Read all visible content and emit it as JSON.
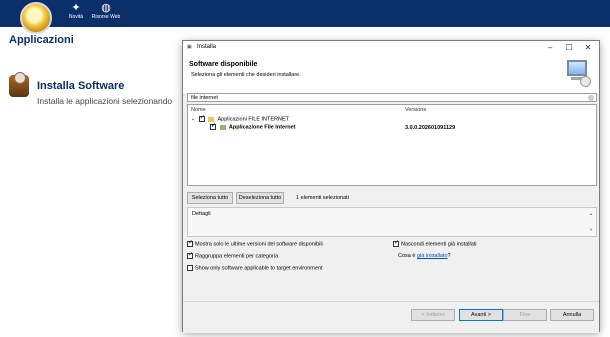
{
  "toolbar": {
    "news": {
      "label": "Novità",
      "icon": "star-icon"
    },
    "web": {
      "label": "Risorse Web",
      "icon": "globe-icon"
    }
  },
  "left": {
    "title": "Applicazioni",
    "install_title": "Installa Software",
    "install_desc": "Installa le applicazioni selezionando"
  },
  "dialog": {
    "title": "Installa",
    "header_title": "Software disponibile",
    "header_sub": "Seleziona gli elementi che desideri installare.",
    "filter": "file internet",
    "columns": {
      "name": "Nome",
      "version": "Versione"
    },
    "tree": {
      "category": "Applicazioni FILE INTERNET",
      "item_name": "Applicazione File Internet",
      "item_version": "3.0.0.202601091129"
    },
    "select_all": "Seleziona tutto",
    "deselect_all": "Deseleziona tutto",
    "selected_info": "1 elementi selezionati",
    "details_label": "Dettagli",
    "options": {
      "latest": "Mostra solo le ultime versioni del software disponibili",
      "group": "Raggruppa elementi per categoria",
      "applicable": "Show only software applicable to target environment",
      "hide_installed": "Nascondi elementi già installati",
      "what_is_prefix": "Cosa è",
      "what_is_link": "già installato",
      "what_is_suffix": "?"
    },
    "buttons": {
      "back": "< Indietro",
      "next": "Avanti >",
      "finish": "Fine",
      "cancel": "Annulla"
    }
  }
}
